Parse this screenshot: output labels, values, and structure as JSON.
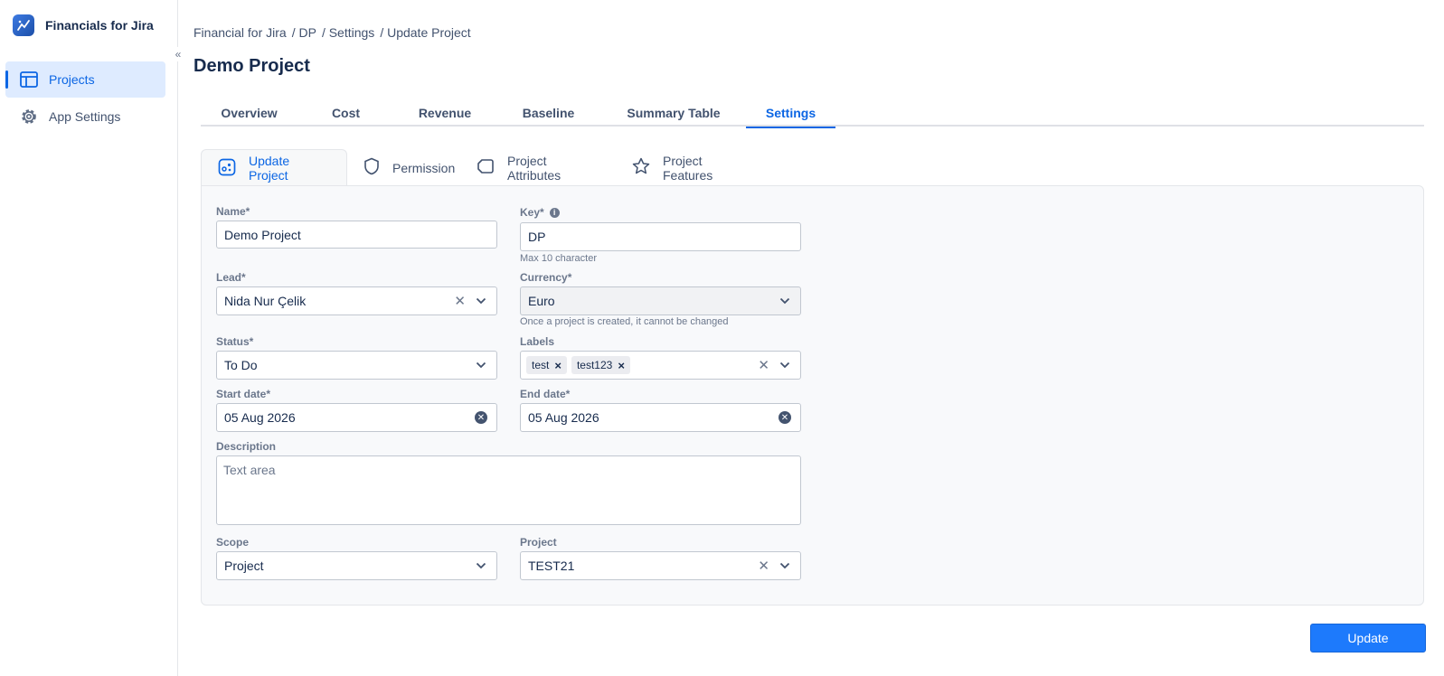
{
  "app": {
    "title": "Financials for Jira"
  },
  "sidebar": {
    "collapse_glyph": "«",
    "items": [
      {
        "label": "Projects",
        "icon": "table-icon",
        "active": true
      },
      {
        "label": "App Settings",
        "icon": "gear-icon",
        "active": false
      }
    ]
  },
  "breadcrumb": [
    "Financial for Jira",
    "/ DP",
    "/ Settings",
    "/ Update Project"
  ],
  "page": {
    "title": "Demo Project"
  },
  "tabs": [
    {
      "label": "Overview"
    },
    {
      "label": "Cost"
    },
    {
      "label": "Revenue"
    },
    {
      "label": "Baseline"
    },
    {
      "label": "Summary Table"
    },
    {
      "label": "Settings",
      "active": true
    }
  ],
  "subtabs": [
    {
      "label": "Update Project",
      "icon": "project-icon",
      "active": true
    },
    {
      "label": "Permission",
      "icon": "shield-icon"
    },
    {
      "label": "Project Attributes",
      "icon": "tag-icon"
    },
    {
      "label": "Project Features",
      "icon": "star-icon"
    }
  ],
  "form": {
    "name": {
      "label": "Name*",
      "value": "Demo Project"
    },
    "key": {
      "label": "Key*",
      "info": "i",
      "value": "DP",
      "helper": "Max 10 character"
    },
    "lead": {
      "label": "Lead*",
      "value": "Nida Nur Çelik"
    },
    "currency": {
      "label": "Currency*",
      "value": "Euro",
      "helper": "Once a project is created, it cannot be changed"
    },
    "status": {
      "label": "Status*",
      "value": "To Do"
    },
    "labels": {
      "label": "Labels",
      "chips": [
        "test",
        "test123"
      ]
    },
    "start_date": {
      "label": "Start date*",
      "value": "05 Aug 2026"
    },
    "end_date": {
      "label": "End date*",
      "value": "05 Aug 2026"
    },
    "description": {
      "label": "Description",
      "placeholder": "Text area"
    },
    "scope": {
      "label": "Scope",
      "value": "Project"
    },
    "project": {
      "label": "Project",
      "value": "TEST21"
    }
  },
  "actions": {
    "update_label": "Update"
  },
  "colors": {
    "accent": "#0c66e4",
    "button": "#1d7afc"
  }
}
